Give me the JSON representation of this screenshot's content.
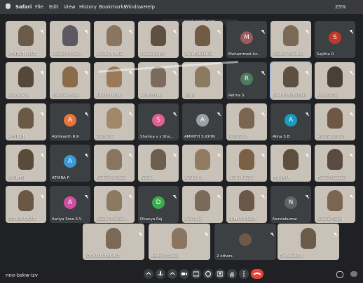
{
  "menubar": {
    "apple": "",
    "items": [
      "Safari",
      "File",
      "Edit",
      "View",
      "History",
      "Bookmarks",
      "Window",
      "Help"
    ],
    "battery": "25%"
  },
  "url": "meet.google.com",
  "participants": [
    {
      "name": "ATHIRA M NAIR",
      "type": "video",
      "color": "#6b5a4a",
      "row": 0,
      "col": 0
    },
    {
      "name": "Meenu S Chan...",
      "type": "video",
      "color": "#5a5a60",
      "row": 0,
      "col": 1
    },
    {
      "name": "Devika B Bhat",
      "type": "video",
      "color": "#8a7560",
      "row": 0,
      "col": 2
    },
    {
      "name": "Aiswarya R.h",
      "type": "video",
      "color": "#605040",
      "row": 0,
      "col": 3
    },
    {
      "name": "Anju Sebastian",
      "type": "video",
      "color": "#705b45",
      "row": 0,
      "col": 4
    },
    {
      "name": "Muhammed An...",
      "type": "avatar",
      "letter": "M",
      "color": "#9c5b5b",
      "row": 0,
      "col": 5
    },
    {
      "name": "Anakha Santho...",
      "type": "video",
      "color": "#7a6a55",
      "row": 0,
      "col": 6
    },
    {
      "name": "Sajitha R",
      "type": "avatar",
      "letter": "S",
      "color": "#c0392b",
      "row": 0,
      "col": 7
    },
    {
      "name": "reema A. M",
      "type": "video",
      "color": "#55483a",
      "row": 1,
      "col": 0
    },
    {
      "name": "Sonia Mathew",
      "type": "video",
      "color": "#8a6d48",
      "row": 1,
      "col": 1
    },
    {
      "name": "Amal Shiyoor",
      "type": "video",
      "color": "#9a7a5a",
      "row": 1,
      "col": 2
    },
    {
      "name": "Arun Chikku",
      "type": "video",
      "color": "#7b6b5c",
      "row": 1,
      "col": 3
    },
    {
      "name": "Pooja",
      "type": "video",
      "color": "#8b7a60",
      "row": 1,
      "col": 4
    },
    {
      "name": "Rehna S",
      "type": "avatar",
      "letter": "R",
      "color": "#4e7a5e",
      "row": 1,
      "col": 5
    },
    {
      "name": "Neethu Sebastian",
      "type": "video",
      "color": "#5e5040",
      "row": 1,
      "col": 6,
      "highlight": true
    },
    {
      "name": "Reshma Raj",
      "type": "video",
      "color": "#4a4035",
      "row": 1,
      "col": 7
    },
    {
      "name": "ATHIRA.M",
      "type": "video",
      "color": "#6a5a45",
      "row": 2,
      "col": 0
    },
    {
      "name": "Abhikanth R.R",
      "type": "avatar",
      "letter": "A",
      "color": "#e8743b",
      "row": 2,
      "col": 1
    },
    {
      "name": "Anupama",
      "type": "video",
      "color": "#a08868",
      "row": 2,
      "col": 2
    },
    {
      "name": "Shahna v s Sha...",
      "type": "avatar",
      "letter": "S",
      "color": "#e06090",
      "row": 2,
      "col": 3
    },
    {
      "name": "AMMITH S JOHN",
      "type": "avatar",
      "letter": "A",
      "color": "#9aa0a6",
      "row": 2,
      "col": 4
    },
    {
      "name": "reshma vj",
      "type": "video",
      "color": "#7a6550",
      "row": 2,
      "col": 5
    },
    {
      "name": "Alina S.B",
      "type": "avatar",
      "letter": "A",
      "color": "#1a9bc0",
      "row": 2,
      "col": 6
    },
    {
      "name": "Anusha suresh",
      "type": "video",
      "color": "#6e5843",
      "row": 2,
      "col": 7
    },
    {
      "name": "ABHIJITH",
      "type": "video",
      "color": "#5a4a3a",
      "row": 3,
      "col": 0
    },
    {
      "name": "ATHIRA P",
      "type": "avatar",
      "letter": "A",
      "color": "#3b9ad9",
      "row": 3,
      "col": 1
    },
    {
      "name": "Reshmi Krishna",
      "type": "video",
      "color": "#8a7560",
      "row": 3,
      "col": 2
    },
    {
      "name": "Reela S",
      "type": "video",
      "color": "#6d5d4d",
      "row": 3,
      "col": 3
    },
    {
      "name": "Anitta S.S",
      "type": "video",
      "color": "#907a60",
      "row": 3,
      "col": 4
    },
    {
      "name": "Binitu Patrick",
      "type": "video",
      "color": "#7a6045",
      "row": 3,
      "col": 5
    },
    {
      "name": "POOJA M",
      "type": "video",
      "color": "#5e4e3e",
      "row": 3,
      "col": 6
    },
    {
      "name": "Thasni Hussain",
      "type": "video",
      "color": "#5a4a40",
      "row": 3,
      "col": 7
    },
    {
      "name": "GOPIKA S NAIR",
      "type": "video",
      "color": "#6a5845",
      "row": 4,
      "col": 0
    },
    {
      "name": "Aariya Sree.S.V",
      "type": "avatar",
      "letter": "A",
      "color": "#d04fa0",
      "row": 4,
      "col": 1
    },
    {
      "name": "Gopika Chandr...",
      "type": "video",
      "color": "#8a7a60",
      "row": 4,
      "col": 2
    },
    {
      "name": "Dhanya Raj",
      "type": "avatar",
      "letter": "D",
      "color": "#3cab4a",
      "row": 4,
      "col": 3
    },
    {
      "name": "Anu Dilip",
      "type": "video",
      "color": "#7a6a58",
      "row": 4,
      "col": 4
    },
    {
      "name": "SREEJA S NAIR",
      "type": "video",
      "color": "#6a5848",
      "row": 4,
      "col": 5
    },
    {
      "name": "Nandakumar",
      "type": "avatar",
      "letter": "N",
      "color": "#5f6368",
      "row": 4,
      "col": 6
    },
    {
      "name": "Anjana Manoj",
      "type": "video",
      "color": "#7a6550",
      "row": 4,
      "col": 7
    }
  ],
  "bottom_row": [
    {
      "name": "ARCHANA SEKHAR",
      "type": "video",
      "color": "#7a6a55"
    },
    {
      "name": "Adithya Dileep",
      "type": "video",
      "color": "#8a7560"
    },
    {
      "name": "2 others",
      "type": "others",
      "color": "#3c4043"
    },
    {
      "name": "Dr. Bindhu S",
      "type": "video",
      "color": "#6a5a48"
    }
  ],
  "meeting_code": "nno-bskw-izv",
  "controls": [
    "chevron-up-icon",
    "mic-icon",
    "chevron-up-icon",
    "camera-icon",
    "captions-icon",
    "emoji-icon",
    "present-icon",
    "raise-hand-icon",
    "more-icon",
    "end-call-icon"
  ]
}
